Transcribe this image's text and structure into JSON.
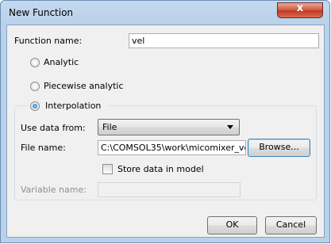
{
  "window": {
    "title": "New Function",
    "close_glyph": "x"
  },
  "form": {
    "function_name_label": "Function name:",
    "function_name_value": "vel",
    "type_options": [
      {
        "label": "Analytic",
        "selected": false
      },
      {
        "label": "Piecewise analytic",
        "selected": false
      },
      {
        "label": "Interpolation",
        "selected": true
      }
    ],
    "use_data_from_label": "Use data from:",
    "use_data_from_value": "File",
    "file_name_label": "File name:",
    "file_name_value": "C:\\COMSOL35\\work\\micomixer_ve",
    "browse_label": "Browse...",
    "store_data_label": "Store data in model",
    "store_data_checked": false,
    "variable_name_label": "Variable name:",
    "variable_name_value": ""
  },
  "buttons": {
    "ok": "OK",
    "cancel": "Cancel"
  },
  "colors": {
    "title_bar": "#b9d1ea",
    "dialog_bg": "#f0f0f0",
    "close_button": "#c9452e"
  }
}
